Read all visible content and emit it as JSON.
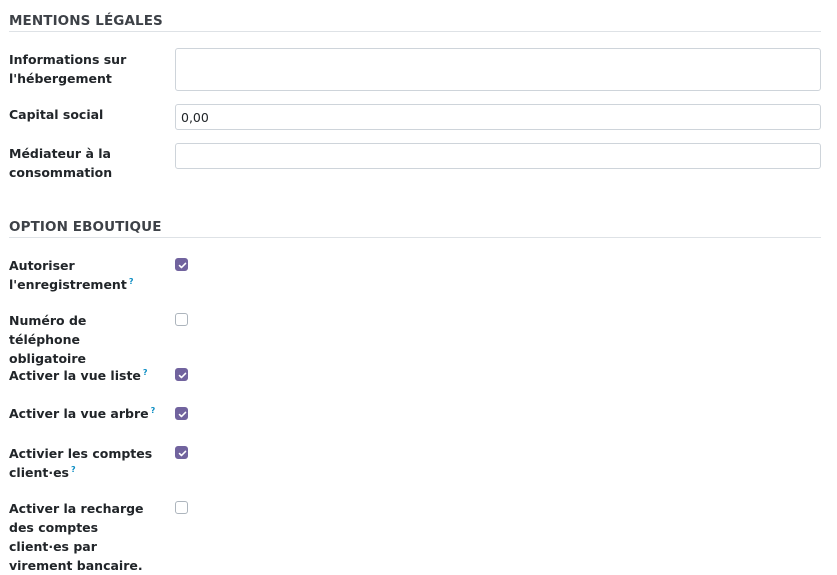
{
  "legal": {
    "title": "MENTIONS LÉGALES",
    "hosting_label": "Informations sur l'hébergement",
    "hosting_value": "",
    "capital_label": "Capital social",
    "capital_value": "0,00",
    "mediator_label": "Médiateur à la consommation",
    "mediator_value": ""
  },
  "eshop": {
    "title": "OPTION EBOUTIQUE",
    "help_mark": "?",
    "options": [
      {
        "label": "Autoriser l'enregistrement",
        "checked": true,
        "help": true
      },
      {
        "label": "Numéro de téléphone obligatoire",
        "checked": false,
        "help": false
      },
      {
        "label": "Activer la vue liste",
        "checked": true,
        "help": true
      },
      {
        "label": "Activer la vue arbre",
        "checked": true,
        "help": true
      },
      {
        "label": "Activier les comptes client·es",
        "checked": true,
        "help": true
      },
      {
        "label": "Activer la recharge des comptes client·es par virement bancaire.",
        "checked": false,
        "help": false
      }
    ]
  },
  "colors": {
    "accent": "#71639e",
    "help": "#0d8ec4",
    "border": "#ced4da"
  }
}
